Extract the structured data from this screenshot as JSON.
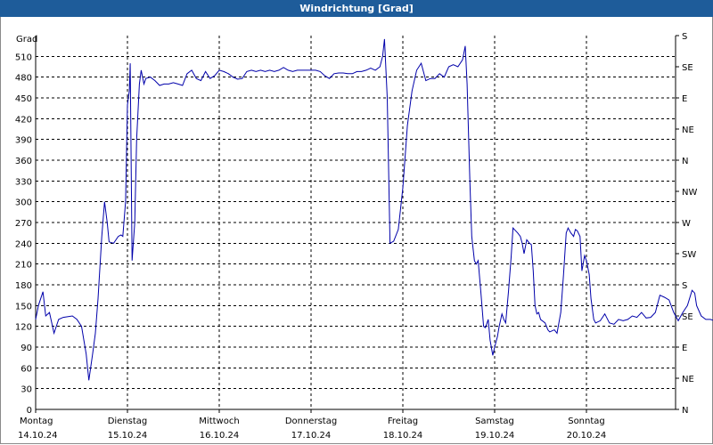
{
  "window": {
    "title": "Windrichtung [Grad]"
  },
  "chart_data": {
    "type": "line",
    "title": "Windrichtung [Grad]",
    "ylabel": "Grad",
    "ylim": [
      0,
      540
    ],
    "y_ticks": [
      0,
      30,
      60,
      90,
      120,
      150,
      180,
      210,
      240,
      270,
      300,
      330,
      360,
      390,
      420,
      450,
      480,
      510
    ],
    "right_ticks": [
      {
        "value": 0,
        "label": "N"
      },
      {
        "value": 45,
        "label": "NE"
      },
      {
        "value": 90,
        "label": "E"
      },
      {
        "value": 135,
        "label": "SE"
      },
      {
        "value": 180,
        "label": "S"
      },
      {
        "value": 225,
        "label": "SW"
      },
      {
        "value": 270,
        "label": "W"
      },
      {
        "value": 315,
        "label": "NW"
      },
      {
        "value": 360,
        "label": "N"
      },
      {
        "value": 405,
        "label": "NE"
      },
      {
        "value": 450,
        "label": "E"
      },
      {
        "value": 495,
        "label": "SE"
      },
      {
        "value": 540,
        "label": "S"
      }
    ],
    "xlim": [
      0,
      7
    ],
    "x_ticks": [
      {
        "value": 0,
        "day": "Montag",
        "date": "14.10.24"
      },
      {
        "value": 1,
        "day": "Dienstag",
        "date": "15.10.24"
      },
      {
        "value": 2,
        "day": "Mittwoch",
        "date": "16.10.24"
      },
      {
        "value": 3,
        "day": "Donnerstag",
        "date": "17.10.24"
      },
      {
        "value": 4,
        "day": "Freitag",
        "date": "18.10.24"
      },
      {
        "value": 5,
        "day": "Samstag",
        "date": "19.10.24"
      },
      {
        "value": 6,
        "day": "Sonntag",
        "date": "20.10.24"
      }
    ],
    "grid": true,
    "colors": {
      "line": "#0000aa",
      "grid": "#000000",
      "titlebar": "#1e5c9a"
    },
    "series": [
      {
        "points": [
          [
            0.0,
            130
          ],
          [
            0.03,
            150
          ],
          [
            0.08,
            170
          ],
          [
            0.11,
            135
          ],
          [
            0.15,
            140
          ],
          [
            0.2,
            110
          ],
          [
            0.25,
            130
          ],
          [
            0.3,
            133
          ],
          [
            0.4,
            135
          ],
          [
            0.45,
            130
          ],
          [
            0.5,
            120
          ],
          [
            0.55,
            80
          ],
          [
            0.58,
            42
          ],
          [
            0.62,
            80
          ],
          [
            0.65,
            110
          ],
          [
            0.68,
            160
          ],
          [
            0.72,
            250
          ],
          [
            0.75,
            300
          ],
          [
            0.78,
            270
          ],
          [
            0.8,
            242
          ],
          [
            0.85,
            240
          ],
          [
            0.9,
            250
          ],
          [
            0.93,
            252
          ],
          [
            0.95,
            250
          ],
          [
            0.98,
            300
          ],
          [
            1.0,
            440
          ],
          [
            1.02,
            460
          ],
          [
            1.03,
            500
          ],
          [
            1.05,
            215
          ],
          [
            1.08,
            270
          ],
          [
            1.1,
            390
          ],
          [
            1.13,
            470
          ],
          [
            1.15,
            490
          ],
          [
            1.18,
            470
          ],
          [
            1.2,
            478
          ],
          [
            1.25,
            480
          ],
          [
            1.3,
            475
          ],
          [
            1.35,
            468
          ],
          [
            1.4,
            470
          ],
          [
            1.45,
            470
          ],
          [
            1.5,
            472
          ],
          [
            1.55,
            470
          ],
          [
            1.6,
            468
          ],
          [
            1.65,
            485
          ],
          [
            1.7,
            490
          ],
          [
            1.75,
            478
          ],
          [
            1.8,
            475
          ],
          [
            1.85,
            488
          ],
          [
            1.9,
            478
          ],
          [
            1.95,
            482
          ],
          [
            2.0,
            490
          ],
          [
            2.05,
            488
          ],
          [
            2.1,
            485
          ],
          [
            2.15,
            480
          ],
          [
            2.2,
            477
          ],
          [
            2.25,
            478
          ],
          [
            2.3,
            488
          ],
          [
            2.35,
            490
          ],
          [
            2.4,
            488
          ],
          [
            2.45,
            490
          ],
          [
            2.5,
            488
          ],
          [
            2.55,
            490
          ],
          [
            2.6,
            488
          ],
          [
            2.65,
            490
          ],
          [
            2.7,
            494
          ],
          [
            2.75,
            490
          ],
          [
            2.8,
            488
          ],
          [
            2.85,
            490
          ],
          [
            2.9,
            490
          ],
          [
            2.95,
            490
          ],
          [
            3.0,
            490
          ],
          [
            3.05,
            490
          ],
          [
            3.1,
            488
          ],
          [
            3.15,
            482
          ],
          [
            3.2,
            478
          ],
          [
            3.25,
            485
          ],
          [
            3.3,
            486
          ],
          [
            3.35,
            486
          ],
          [
            3.4,
            485
          ],
          [
            3.45,
            485
          ],
          [
            3.5,
            488
          ],
          [
            3.55,
            488
          ],
          [
            3.6,
            490
          ],
          [
            3.65,
            493
          ],
          [
            3.7,
            490
          ],
          [
            3.75,
            495
          ],
          [
            3.78,
            510
          ],
          [
            3.8,
            535
          ],
          [
            3.83,
            450
          ],
          [
            3.86,
            240
          ],
          [
            3.9,
            243
          ],
          [
            3.95,
            260
          ],
          [
            4.0,
            320
          ],
          [
            4.05,
            410
          ],
          [
            4.1,
            460
          ],
          [
            4.15,
            490
          ],
          [
            4.2,
            500
          ],
          [
            4.25,
            475
          ],
          [
            4.3,
            478
          ],
          [
            4.35,
            478
          ],
          [
            4.4,
            485
          ],
          [
            4.45,
            480
          ],
          [
            4.5,
            495
          ],
          [
            4.55,
            498
          ],
          [
            4.6,
            495
          ],
          [
            4.65,
            505
          ],
          [
            4.68,
            525
          ],
          [
            4.7,
            470
          ],
          [
            4.73,
            330
          ],
          [
            4.75,
            250
          ],
          [
            4.78,
            215
          ],
          [
            4.8,
            210
          ],
          [
            4.82,
            215
          ],
          [
            4.85,
            170
          ],
          [
            4.88,
            120
          ],
          [
            4.9,
            118
          ],
          [
            4.93,
            130
          ],
          [
            4.95,
            100
          ],
          [
            4.98,
            78
          ],
          [
            5.0,
            90
          ],
          [
            5.03,
            105
          ],
          [
            5.05,
            120
          ],
          [
            5.08,
            138
          ],
          [
            5.1,
            130
          ],
          [
            5.12,
            125
          ],
          [
            5.15,
            170
          ],
          [
            5.18,
            220
          ],
          [
            5.2,
            262
          ],
          [
            5.25,
            255
          ],
          [
            5.28,
            250
          ],
          [
            5.3,
            240
          ],
          [
            5.32,
            225
          ],
          [
            5.35,
            245
          ],
          [
            5.38,
            240
          ],
          [
            5.4,
            238
          ],
          [
            5.42,
            200
          ],
          [
            5.44,
            150
          ],
          [
            5.46,
            138
          ],
          [
            5.48,
            140
          ],
          [
            5.5,
            130
          ],
          [
            5.55,
            125
          ],
          [
            5.58,
            115
          ],
          [
            5.6,
            112
          ],
          [
            5.65,
            115
          ],
          [
            5.68,
            110
          ],
          [
            5.72,
            140
          ],
          [
            5.75,
            195
          ],
          [
            5.78,
            255
          ],
          [
            5.8,
            262
          ],
          [
            5.83,
            255
          ],
          [
            5.86,
            250
          ],
          [
            5.88,
            260
          ],
          [
            5.9,
            258
          ],
          [
            5.93,
            250
          ],
          [
            5.95,
            200
          ],
          [
            5.98,
            222
          ],
          [
            6.0,
            215
          ],
          [
            6.03,
            195
          ],
          [
            6.05,
            160
          ],
          [
            6.08,
            130
          ],
          [
            6.1,
            125
          ],
          [
            6.15,
            128
          ],
          [
            6.2,
            138
          ],
          [
            6.25,
            125
          ],
          [
            6.3,
            123
          ],
          [
            6.35,
            130
          ],
          [
            6.4,
            128
          ],
          [
            6.45,
            130
          ],
          [
            6.5,
            135
          ],
          [
            6.55,
            133
          ],
          [
            6.6,
            140
          ],
          [
            6.65,
            132
          ],
          [
            6.7,
            133
          ],
          [
            6.75,
            140
          ],
          [
            6.8,
            165
          ],
          [
            6.85,
            162
          ],
          [
            6.9,
            158
          ],
          [
            6.95,
            140
          ],
          [
            7.0,
            128
          ],
          [
            7.05,
            140
          ],
          [
            7.1,
            150
          ],
          [
            7.15,
            172
          ],
          [
            7.18,
            168
          ],
          [
            7.2,
            150
          ],
          [
            7.25,
            135
          ],
          [
            7.3,
            130
          ],
          [
            7.35,
            130
          ],
          [
            7.4,
            128
          ],
          [
            7.45,
            130
          ],
          [
            7.5,
            130
          ]
        ]
      }
    ]
  }
}
